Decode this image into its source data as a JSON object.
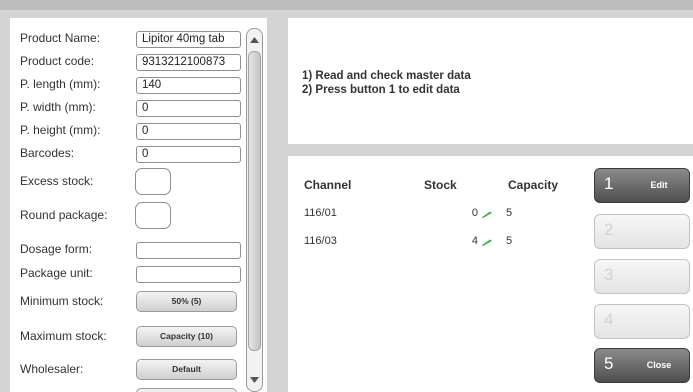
{
  "product_form": {
    "name_label": "Product Name:",
    "name_value": "Lipitor 40mg tab",
    "code_label": "Product code:",
    "code_value": "9313212100873",
    "length_label": "P. length (mm):",
    "length_value": "140",
    "width_label": "P. width (mm):",
    "width_value": "0",
    "height_label": "P. height (mm):",
    "height_value": "0",
    "barcodes_label": "Barcodes:",
    "barcodes_value": "0",
    "excess_stock_label": "Excess stock:",
    "round_package_label": "Round package:",
    "dosage_form_label": "Dosage form:",
    "dosage_form_value": "",
    "package_unit_label": "Package unit:",
    "package_unit_value": "",
    "minimum_stock_label": "Minimum stock:",
    "minimum_stock_button": "50% (5)",
    "maximum_stock_label": "Maximum stock:",
    "maximum_stock_button": "Capacity (10)",
    "wholesaler_label": "Wholesaler:",
    "wholesaler_button": "Default"
  },
  "instructions": {
    "line1": "1) Read and check master data",
    "line2": "2) Press button 1 to edit data"
  },
  "stock_table": {
    "headers": {
      "channel": "Channel",
      "stock": "Stock",
      "capacity": "Capacity"
    },
    "rows": [
      {
        "channel": "116/01",
        "stock": "0",
        "capacity": "5"
      },
      {
        "channel": "116/03",
        "stock": "4",
        "capacity": "5"
      }
    ]
  },
  "side_buttons": [
    {
      "number": "1",
      "label": "Edit",
      "enabled": true
    },
    {
      "number": "2",
      "label": "",
      "enabled": false
    },
    {
      "number": "3",
      "label": "",
      "enabled": false
    },
    {
      "number": "4",
      "label": "",
      "enabled": false
    },
    {
      "number": "5",
      "label": "Close",
      "enabled": true
    }
  ],
  "icons": {
    "stock_icon": "pencil-icon",
    "scroll_up": "chevron-up-icon",
    "scroll_down": "chevron-down-icon"
  },
  "colors": {
    "accent_button": "#5e5e5e",
    "stock_icon": "#4caf50",
    "background": "#d4d4d4"
  }
}
